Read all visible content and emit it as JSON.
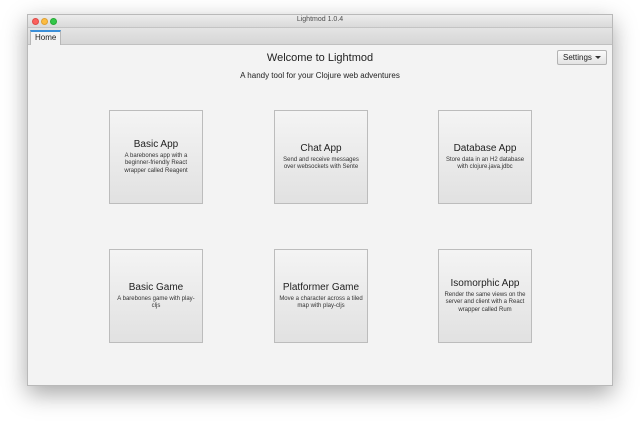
{
  "window": {
    "title": "Lightmod 1.0.4"
  },
  "tabs": [
    {
      "label": "Home"
    }
  ],
  "header": {
    "title": "Welcome to Lightmod",
    "subtitle": "A handy tool for your Clojure web adventures",
    "settings_label": "Settings"
  },
  "cards": [
    {
      "title": "Basic App",
      "desc": "A barebones app with a beginner-friendly React wrapper called Reagent"
    },
    {
      "title": "Chat App",
      "desc": "Send and receive messages over websockets with Sente"
    },
    {
      "title": "Database App",
      "desc": "Store data in an H2 database with clojure.java.jdbc"
    },
    {
      "title": "Basic Game",
      "desc": "A barebones game with play-cljs"
    },
    {
      "title": "Platformer Game",
      "desc": "Move a character across a tiled map with play-cljs"
    },
    {
      "title": "Isomorphic App",
      "desc": "Render the same views on the server and client with a React wrapper called Rum"
    }
  ],
  "colors": {
    "accent": "#3a8fd9",
    "close": "#fc605c",
    "minimize": "#fdbc40",
    "maximize": "#34c84a"
  }
}
